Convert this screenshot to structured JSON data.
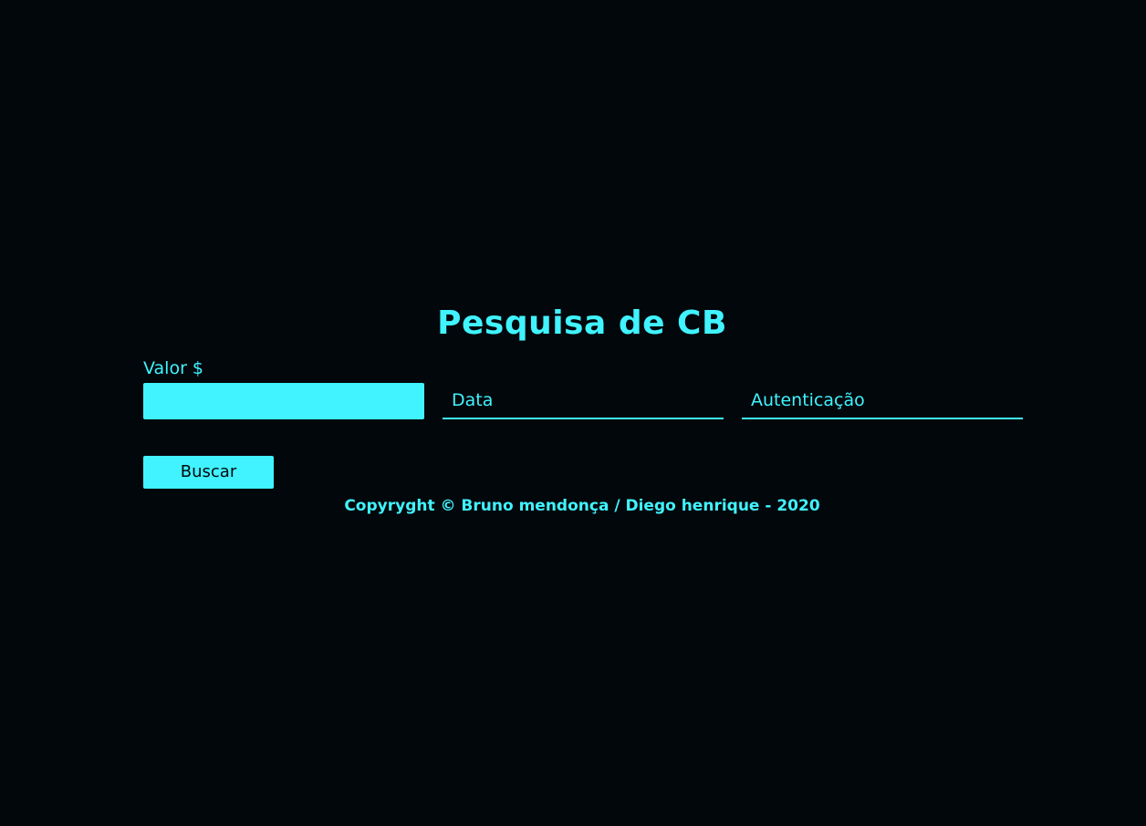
{
  "header": {
    "title": "Pesquisa de CB"
  },
  "form": {
    "valor_label": "Valor $",
    "valor_value": "",
    "data_placeholder": "Data",
    "autenticacao_placeholder": "Autenticação",
    "buscar_label": "Buscar"
  },
  "footer": {
    "copyright": "Copyryght © Bruno mendonça / Diego henrique - 2020"
  },
  "colors": {
    "background": "#02070b",
    "accent": "#40f3ff"
  }
}
